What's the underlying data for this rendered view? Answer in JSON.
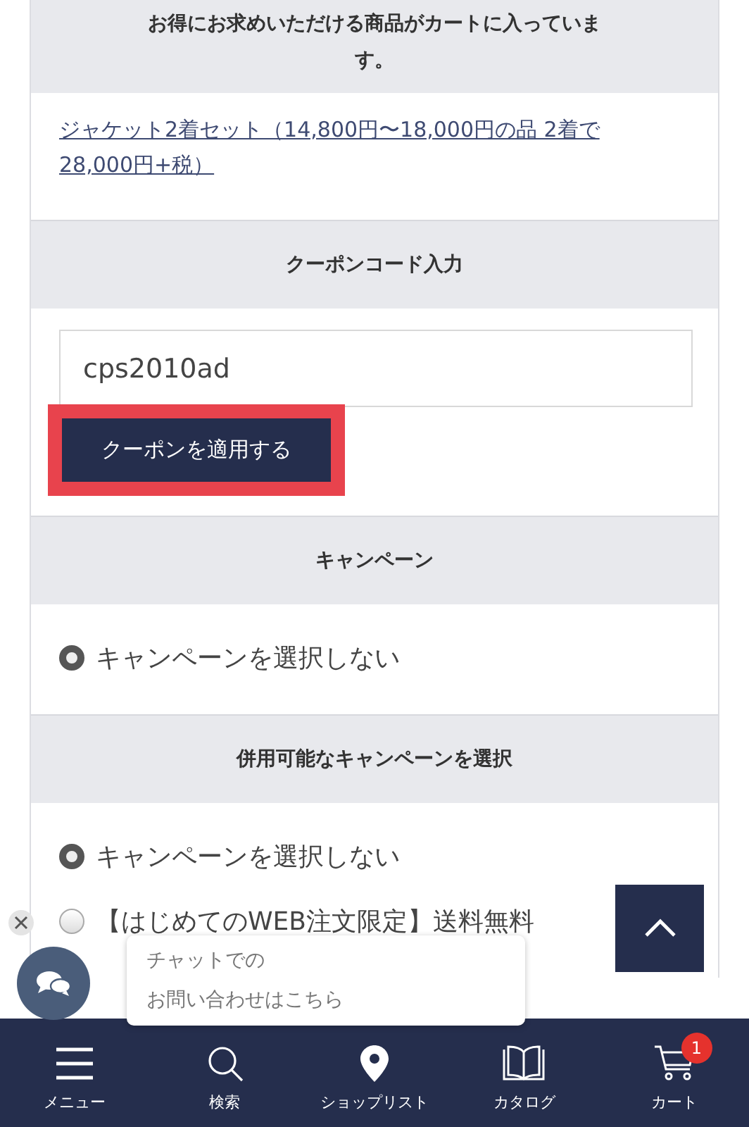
{
  "notice": {
    "heading": "お得にお求めいただける商品がカートに入っています。",
    "link": "ジャケット2着セット（14,800円〜18,000円の品 2着で28,000円+税）"
  },
  "coupon": {
    "heading": "クーポンコード入力",
    "value": "cps2010ad",
    "button": "クーポンを適用する",
    "highlighted": true
  },
  "campaign": {
    "heading": "キャンペーン",
    "options": [
      {
        "label": "キャンペーンを選択しない",
        "selected": true
      }
    ]
  },
  "combined_campaign": {
    "heading": "併用可能なキャンペーンを選択",
    "options": [
      {
        "label": "キャンペーンを選択しない",
        "selected": true
      },
      {
        "label": "【はじめてのWEB注文限定】送料無料",
        "selected": false
      }
    ]
  },
  "chat": {
    "lines": [
      "チャットでの",
      "お問い合わせはこちら"
    ]
  },
  "bottom_nav": [
    {
      "kind": "menu",
      "label": "メニュー"
    },
    {
      "kind": "search",
      "label": "検索"
    },
    {
      "kind": "pin",
      "label": "ショップリスト"
    },
    {
      "kind": "book",
      "label": "カタログ"
    },
    {
      "kind": "cart",
      "label": "カート",
      "badge": "1"
    }
  ]
}
